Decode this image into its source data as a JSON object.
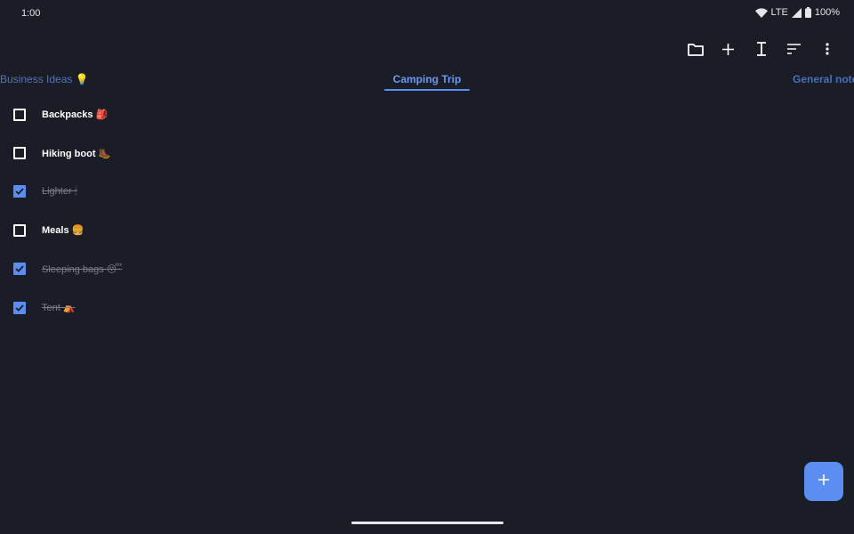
{
  "status_bar": {
    "time": "1:00",
    "network": "LTE",
    "battery": "100%"
  },
  "toolbar": {
    "icons": [
      "folder-icon",
      "plus-icon",
      "text-cursor-icon",
      "sort-icon",
      "more-vert-icon"
    ]
  },
  "tabs": [
    {
      "label": "Business Ideas 💡",
      "selected": false
    },
    {
      "label": "Camping Trip",
      "selected": true
    },
    {
      "label": "General note",
      "selected": false
    }
  ],
  "items": [
    {
      "label": "Backpacks 🎒",
      "checked": false
    },
    {
      "label": "Hiking boot 🥾",
      "checked": false
    },
    {
      "label": "Lighter 🕯",
      "checked": true
    },
    {
      "label": "Meals 🍔",
      "checked": false
    },
    {
      "label": "Sleeping bags 😴",
      "checked": true
    },
    {
      "label": "Tent ⛺",
      "checked": true
    }
  ],
  "colors": {
    "background": "#1a1c26",
    "accent": "#5c8df0",
    "checked_text": "#7b7d87"
  }
}
